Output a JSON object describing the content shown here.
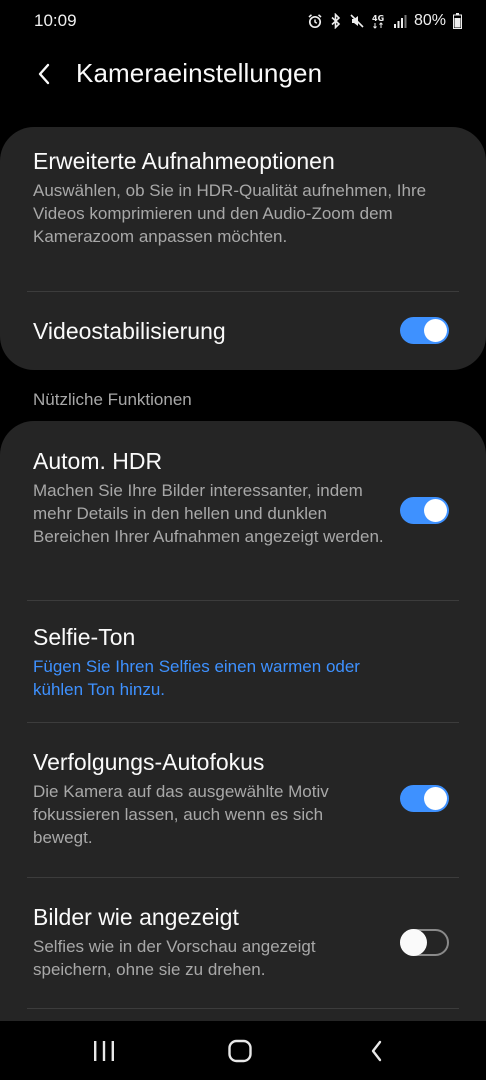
{
  "status_bar": {
    "time": "10:09",
    "network": "4G",
    "battery": "80%",
    "icons": [
      "alarm-icon",
      "bluetooth-icon",
      "mute-icon",
      "network-4g-icon",
      "signal-icon",
      "battery-icon"
    ]
  },
  "header": {
    "title": "Kameraeinstellungen",
    "back_icon": "back-arrow-icon"
  },
  "card1": {
    "items": [
      {
        "title": "Erweiterte Aufnahmeoptionen",
        "desc": "Auswählen, ob Sie in HDR-Qualität aufnehmen, Ihre Videos komprimieren und den Audio-Zoom dem Kamerazoom anpassen möchten."
      },
      {
        "title": "Videostabilisierung",
        "toggle": true
      }
    ]
  },
  "section": {
    "header": "Nützliche Funktionen"
  },
  "card2": {
    "items": [
      {
        "title": "Autom. HDR",
        "desc": "Machen Sie Ihre Bilder interessanter, indem mehr Details in den hellen und dunklen Bereichen Ihrer Aufnahmen angezeigt werden.",
        "toggle": true
      },
      {
        "title": "Selfie-Ton",
        "desc": "Fügen Sie Ihren Selfies einen warmen oder kühlen Ton hinzu."
      },
      {
        "title": "Verfolgungs-Autofokus",
        "desc": "Die Kamera auf das ausgewählte Motiv fokussieren lassen, auch wenn es sich bewegt.",
        "toggle": true
      },
      {
        "title": "Bilder wie angezeigt",
        "desc": "Selfies wie in der Vorschau angezeigt speichern, ohne sie zu drehen.",
        "toggle": false
      }
    ]
  },
  "nav_bar": {
    "icons": [
      "recent-apps-icon",
      "home-icon",
      "back-icon"
    ]
  },
  "colors": {
    "accent": "#3e91ff",
    "card_bg": "#252525",
    "background": "#000000",
    "secondary_text": "#a8a8a8"
  }
}
